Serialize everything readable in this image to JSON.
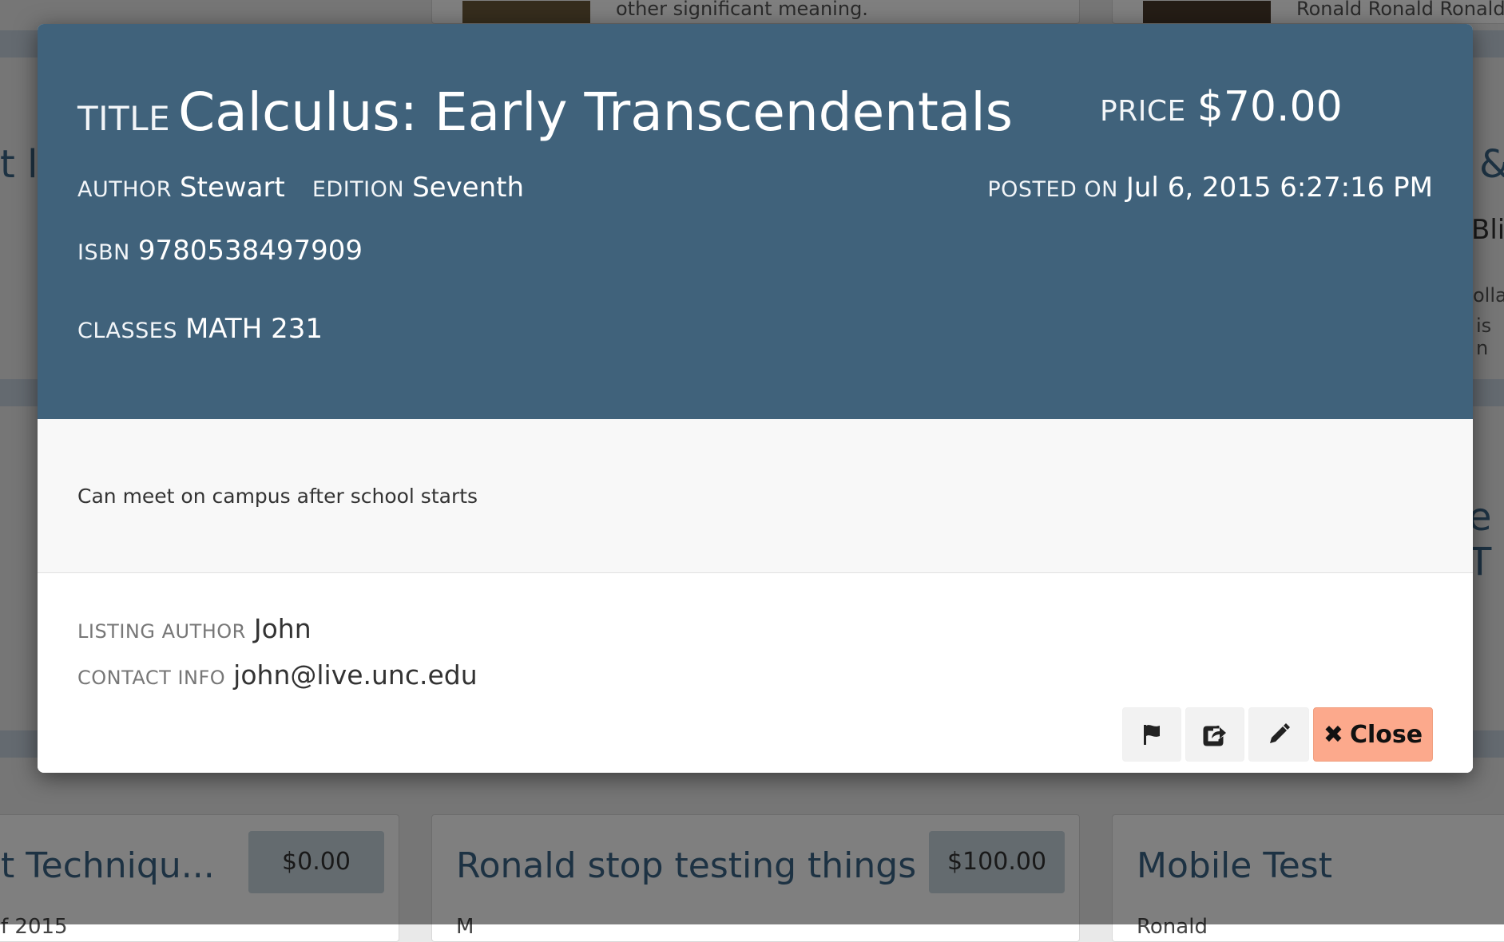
{
  "background": {
    "top_snippet_left": "other significant meaning.",
    "top_snippet_right": "Ronald Ronald Ronald R",
    "left_fragments": [
      "t li"
    ],
    "right_fragments": [
      "&",
      "Blin",
      "olla",
      "is n",
      "e T"
    ],
    "cards": [
      {
        "title": "t Techniqu...",
        "price": "$0.00",
        "subtitle": "f 2015"
      },
      {
        "title": "Ronald stop testing things",
        "price": "$100.00",
        "subtitle": "M"
      },
      {
        "title": "Mobile Test",
        "price": "",
        "subtitle": "Ronald"
      }
    ]
  },
  "modal": {
    "title_label": "Title",
    "title": "Calculus: Early Transcendentals",
    "price_label": "Price",
    "price": "$70.00",
    "author_label": "Author",
    "author": "Stewart",
    "edition_label": "Edition",
    "edition": "Seventh",
    "posted_label": "Posted on",
    "posted": "Jul 6, 2015 6:27:16 PM",
    "isbn_label": "ISBN",
    "isbn": "9780538497909",
    "classes_label": "Classes",
    "classes": "MATH 231",
    "note": "Can meet on campus after school starts",
    "listing_author_label": "Listing Author",
    "listing_author": "John",
    "contact_label": "Contact Info",
    "contact": "john@live.unc.edu",
    "close_label": "Close"
  },
  "icons": {
    "flag": "flag-icon",
    "share": "share-icon",
    "edit": "pencil-icon",
    "close": "close-icon"
  },
  "colors": {
    "header_bg": "#40627b",
    "close_bg": "#fca98c",
    "card_title": "#3a6586"
  }
}
